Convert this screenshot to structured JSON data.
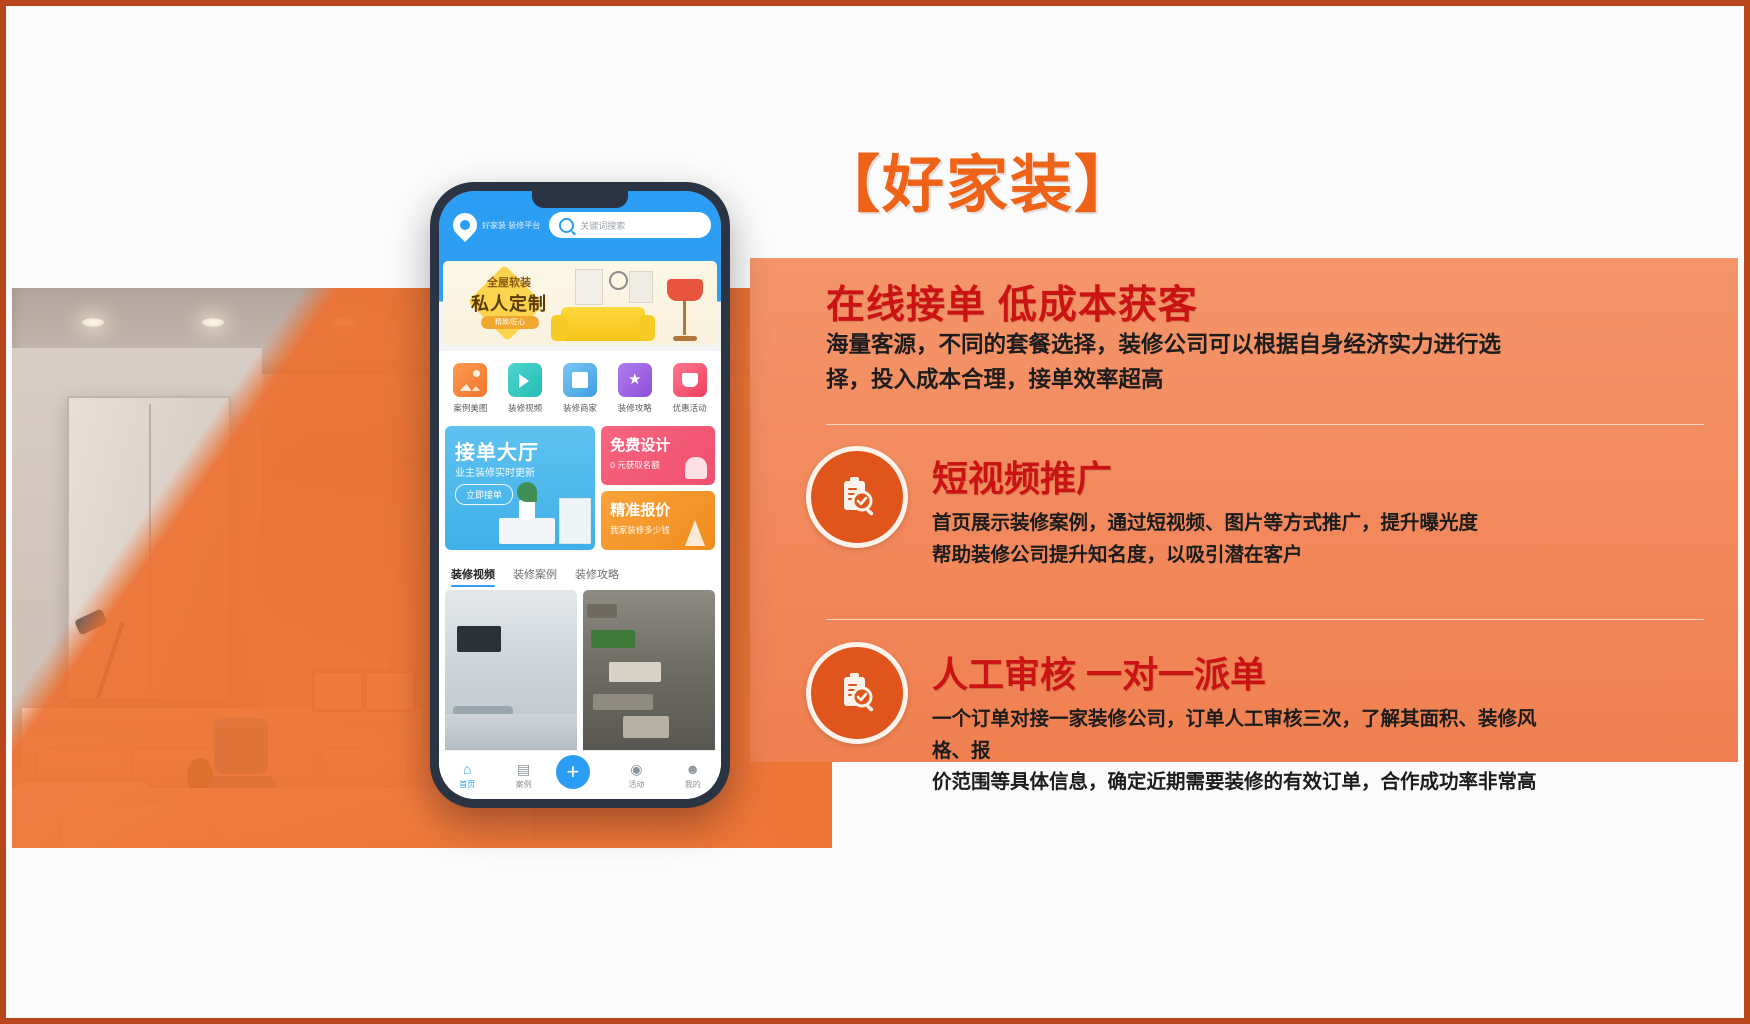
{
  "poster": {
    "brand_title": "【好家装】",
    "brand_color": "#ef6318",
    "panel_color": "#f2885b",
    "headline_color": "#cc1313",
    "border_color": "#b9461a"
  },
  "sections": [
    {
      "heading": "在线接单  低成本获客",
      "body": "海量客源，不同的套餐选择，装修公司可以根据自身经济实力进行选择，投入成本合理，接单效率超高"
    },
    {
      "icon": "clipboard-search-icon",
      "heading": "短视频推广",
      "body_line1": "首页展示装修案例，通过短视频、图片等方式推广，提升曝光度",
      "body_line2": "帮助装修公司提升知名度，以吸引潜在客户"
    },
    {
      "icon": "clipboard-search-icon",
      "heading": "人工审核 一对一派单",
      "body_line1": "一个订单对接一家装修公司，订单人工审核三次，了解其面积、装修风格、报",
      "body_line2": "价范围等具体信息，确定近期需要装修的有效订单，合作成功率非常高"
    }
  ],
  "phone": {
    "header": {
      "logo_text": "好家装 装修平台",
      "search_placeholder": "关键词搜索",
      "search_icon": "search-icon",
      "logo_icon": "location-pin-icon"
    },
    "hero": {
      "line1": "全屋软装",
      "line2": "私人定制",
      "tag": "精致/匠心"
    },
    "quick_icons": [
      {
        "label": "案例美图",
        "icon": "photo-icon",
        "color": "#f0762a"
      },
      {
        "label": "装修视频",
        "icon": "video-camera-icon",
        "color": "#22bdb4"
      },
      {
        "label": "装修商家",
        "icon": "store-card-icon",
        "color": "#3e9fe0"
      },
      {
        "label": "装修攻略",
        "icon": "star-book-icon",
        "color": "#8b4fd8"
      },
      {
        "label": "优惠活动",
        "icon": "gift-icon",
        "color": "#ef3d5f"
      }
    ],
    "cards": {
      "main": {
        "title": "接单大厅",
        "subtitle": "业主装修实时更新",
        "button": "立即接单"
      },
      "small": [
        {
          "title": "免费设计",
          "subtitle": "0 元获取名额"
        },
        {
          "title": "精准报价",
          "subtitle": "我家装修多少钱"
        }
      ]
    },
    "tabs": [
      {
        "label": "装修视频",
        "active": true
      },
      {
        "label": "装修案例",
        "active": false
      },
      {
        "label": "装修攻略",
        "active": false
      }
    ],
    "bottom_nav": [
      {
        "label": "首页",
        "icon": "home-icon",
        "active": true
      },
      {
        "label": "案例",
        "icon": "cases-icon",
        "active": false
      },
      {
        "label": "发布",
        "icon": "plus-icon",
        "active": false
      },
      {
        "label": "活动",
        "icon": "activity-icon",
        "active": false
      },
      {
        "label": "我的",
        "icon": "user-icon",
        "active": false
      }
    ]
  }
}
